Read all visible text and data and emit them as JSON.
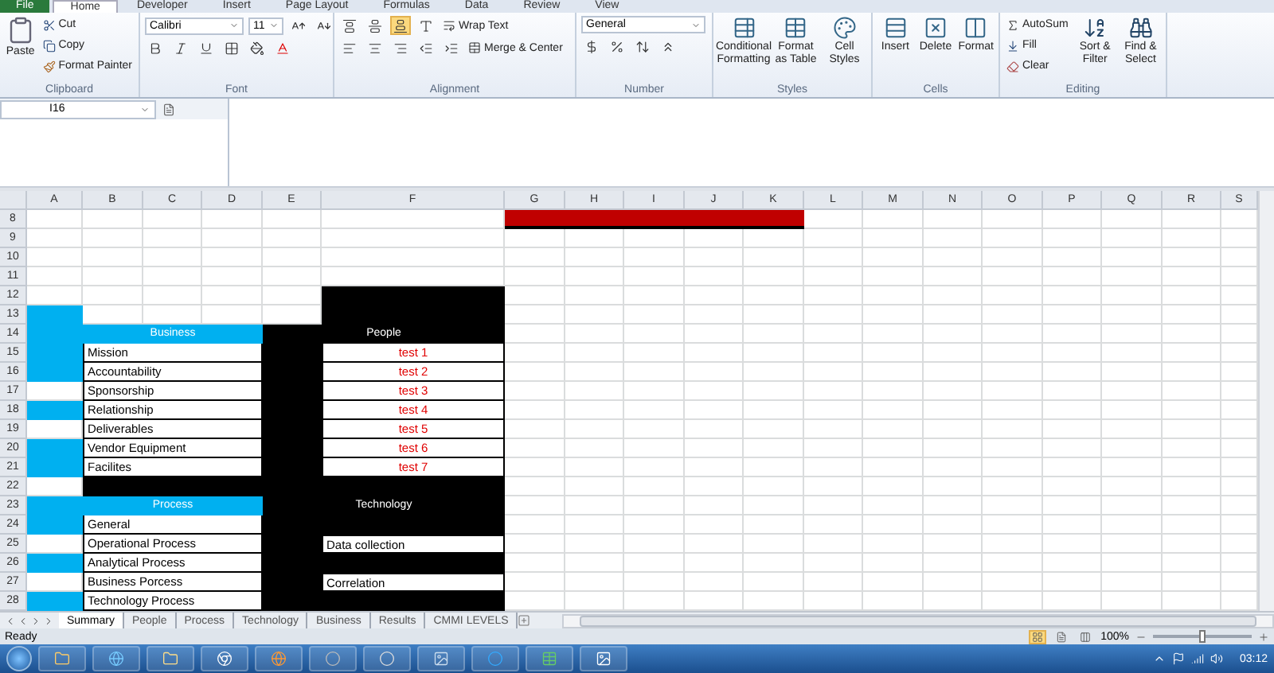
{
  "ribbon_tabs": [
    {
      "label": "File",
      "kind": "file",
      "selected": false
    },
    {
      "label": "Home",
      "kind": "tab",
      "selected": true
    },
    {
      "label": "Developer",
      "kind": "tab",
      "selected": false
    },
    {
      "label": "Insert",
      "kind": "tab",
      "selected": false
    },
    {
      "label": "Page Layout",
      "kind": "tab",
      "selected": false
    },
    {
      "label": "Formulas",
      "kind": "tab",
      "selected": false
    },
    {
      "label": "Data",
      "kind": "tab",
      "selected": false
    },
    {
      "label": "Review",
      "kind": "tab",
      "selected": false
    },
    {
      "label": "View",
      "kind": "tab",
      "selected": false
    }
  ],
  "clipboard": {
    "label": "Clipboard",
    "paste": "Paste",
    "cut": "Cut",
    "copy": "Copy",
    "format_painter": "Format Painter"
  },
  "font": {
    "label": "Font",
    "font_name": "Calibri",
    "font_size": "11"
  },
  "alignment": {
    "label": "Alignment",
    "wrap_text": "Wrap Text",
    "merge": "Merge & Center",
    "vertical_align": [
      {
        "selected": false
      },
      {
        "selected": false
      },
      {
        "selected": true
      }
    ]
  },
  "number": {
    "label": "Number",
    "format": "General"
  },
  "styles": {
    "label": "Styles",
    "buttons": [
      "Conditional Formatting",
      "Format as Table",
      "Cell Styles"
    ]
  },
  "cells": {
    "label": "Cells",
    "buttons": [
      "Insert",
      "Delete",
      "Format"
    ]
  },
  "editing": {
    "label": "Editing",
    "autosum": "AutoSum",
    "fill": "Fill",
    "clear": "Clear",
    "sort": "Sort & Filter",
    "find": "Find & Select"
  },
  "formula_bar": {
    "name_box": "I16"
  },
  "sheet": {
    "columns": [
      "A",
      "B",
      "C",
      "D",
      "E",
      "F",
      "G",
      "H",
      "I",
      "J",
      "K",
      "L",
      "M",
      "N",
      "O",
      "P",
      "Q",
      "R",
      "S"
    ],
    "rows": [
      "8",
      "9",
      "10",
      "11",
      "12",
      "13",
      "14",
      "15",
      "16",
      "17",
      "18",
      "19",
      "20",
      "21",
      "22",
      "23",
      "24",
      "25",
      "26",
      "27",
      "28"
    ],
    "business": {
      "title": "Business",
      "items": [
        "Mission",
        "Accountability",
        "Sponsorship",
        "Relationship",
        "Deliverables",
        "Vendor Equipment",
        "Facilites"
      ]
    },
    "people": {
      "title": "People",
      "items": [
        "test 1",
        "test 2",
        "test 3",
        "test 4",
        "test 5",
        "test 6",
        "test 7"
      ]
    },
    "process": {
      "title": "Process",
      "items": [
        "General",
        "Operational Process",
        "Analytical Process",
        "Business Porcess",
        "Technology Process"
      ]
    },
    "technology": {
      "title": "Technology",
      "items": [
        "Data collection",
        "Correlation"
      ]
    }
  },
  "sheet_tabs": [
    {
      "label": "Summary",
      "selected": true
    },
    {
      "label": "People",
      "selected": false
    },
    {
      "label": "Process",
      "selected": false
    },
    {
      "label": "Technology",
      "selected": false
    },
    {
      "label": "Business",
      "selected": false
    },
    {
      "label": "Results",
      "selected": false
    },
    {
      "label": "CMMI LEVELS",
      "selected": false
    }
  ],
  "status_bar": {
    "status": "Ready",
    "zoom": "100%",
    "views": [
      {
        "selected": true
      },
      {
        "selected": false
      },
      {
        "selected": false
      }
    ],
    "zoom_slider": {
      "level": 0.5
    }
  },
  "taskbar": {
    "time": "03:12"
  }
}
